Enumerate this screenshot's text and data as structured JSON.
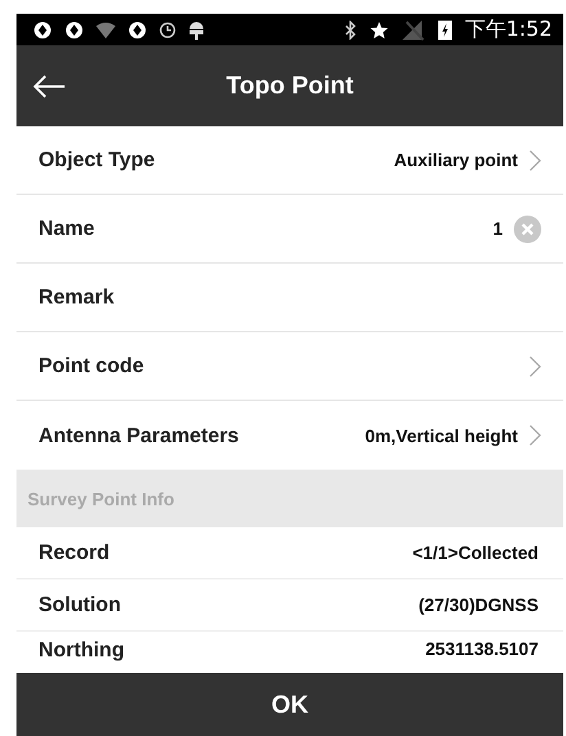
{
  "status_bar": {
    "time": "下午1:52"
  },
  "toolbar": {
    "title": "Topo Point"
  },
  "fields": [
    {
      "label": "Object Type",
      "value": "Auxiliary point",
      "kind": "chevron"
    },
    {
      "label": "Name",
      "value": "1",
      "kind": "clear"
    },
    {
      "label": "Remark",
      "kind": "plain"
    },
    {
      "label": "Point code",
      "kind": "chevron"
    },
    {
      "label": "Antenna Parameters",
      "value": "0m,Vertical height",
      "kind": "chevron"
    }
  ],
  "section": {
    "title": "Survey Point Info"
  },
  "info_rows": [
    {
      "label": "Record",
      "value": "<1/1>Collected"
    },
    {
      "label": "Solution",
      "value": "(27/30)DGNSS"
    },
    {
      "label": "Northing",
      "value": "2531138.5107"
    }
  ],
  "ok_button": {
    "label": "OK"
  }
}
